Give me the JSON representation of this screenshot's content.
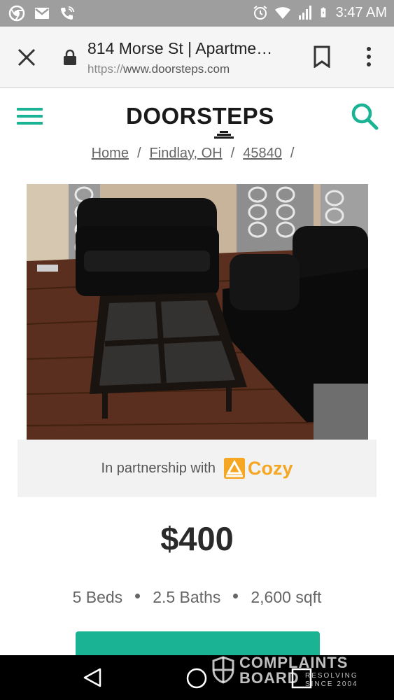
{
  "status_bar": {
    "time": "3:47 AM",
    "icons_left": [
      "chrome-icon",
      "gmail-icon",
      "phone-call-icon"
    ],
    "icons_right": [
      "alarm-icon",
      "wifi-icon",
      "signal-icon",
      "battery-icon"
    ]
  },
  "browser": {
    "page_title": "814 Morse St | Apartme…",
    "url_scheme": "https://",
    "url_host": "www.doorsteps.com"
  },
  "site": {
    "logo": "DOORSTEPS",
    "breadcrumb": [
      {
        "label": "Home"
      },
      {
        "label": "Findlay, OH"
      },
      {
        "label": "45840"
      }
    ],
    "breadcrumb_separator": "/"
  },
  "listing": {
    "photo_alt": "living-room-photo",
    "partner_text": "In partnership with",
    "partner_brand": "Cozy",
    "price": "$400",
    "beds": "5 Beds",
    "baths": "2.5 Baths",
    "sqft": "2,600 sqft"
  },
  "watermark": {
    "line1": "COMPLAINTS",
    "line2": "BOARD",
    "sub1": "RESOLVING",
    "sub2": "SINCE 2004"
  },
  "colors": {
    "accent": "#1ab394",
    "status_bar": "#9e9e9e",
    "cozy": "#f5a623",
    "nav_bar": "#000000"
  }
}
